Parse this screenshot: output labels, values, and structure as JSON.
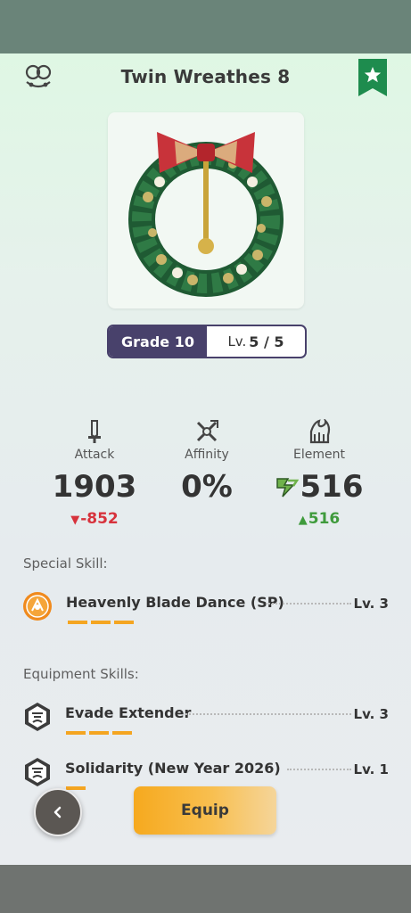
{
  "header": {
    "title": "Twin Wreathes 8"
  },
  "icons": {
    "set_bonus": "twin-wreath-set-icon",
    "favorite": "star-bookmark-icon",
    "attack": "sword-icon",
    "affinity": "crossed-blades-icon",
    "element": "flame-claw-icon",
    "element_type": "thunder-element-icon",
    "special_skill": "heavenly-blade-dance-skill-icon",
    "equipment_skill": "hexagon-skill-icon",
    "back": "chevron-left-icon"
  },
  "colors": {
    "accent_purple": "#48416b",
    "favorite_green": "#1e8c4e",
    "increase_green": "#3f9b3c",
    "decrease_red": "#d7323c",
    "skill_bar_orange": "#f4a521",
    "equip_button_orange": "#f6a91e"
  },
  "grade": {
    "label": "Grade 10",
    "level_prefix": "Lv.",
    "level_value": "5 / 5"
  },
  "stats": {
    "attack": {
      "label": "Attack",
      "value": "1903",
      "delta": "-852",
      "delta_direction": "down"
    },
    "affinity": {
      "label": "Affinity",
      "value": "0%"
    },
    "element": {
      "label": "Element",
      "value": "516",
      "delta": "516",
      "delta_direction": "up"
    }
  },
  "special_skill": {
    "section_label": "Special Skill:",
    "name": "Heavenly Blade Dance (SP)",
    "level": "Lv. 3",
    "bars": 3
  },
  "equipment_skills": {
    "section_label": "Equipment Skills:",
    "items": [
      {
        "name": "Evade Extender",
        "level": "Lv. 3",
        "bars": 3
      },
      {
        "name": "Solidarity (New Year 2026)",
        "level": "Lv. 1",
        "bars": 1
      }
    ]
  },
  "actions": {
    "equip_label": "Equip"
  }
}
